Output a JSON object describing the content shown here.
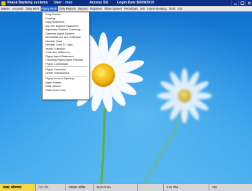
{
  "titlebar": {
    "app_name": "Vbank Banking systems",
    "user_label": "User :",
    "user_value": "msc",
    "access_label": "Access :",
    "access_value": "SU",
    "login_label": "Login Date :",
    "login_value": "16/09/2015"
  },
  "menubar": {
    "items": [
      "Master",
      "Accounts",
      "Daily Work",
      "Pigmy Work",
      "Daily Reports",
      "Reports",
      "Registers",
      "Share System",
      "Periodicals",
      "MIS",
      "House Keeping",
      "Tools",
      "Exit"
    ],
    "active_index": 3
  },
  "dropdown": {
    "items": [
      "Daily Entries",
      "Passing",
      "Daily Statement",
      "Ind. A/C Balance Statement",
      "Agentwise Balance Summary",
      "Datewise Agent Balance",
      "Monthwise Ind. A/C Collection",
      "Monthly Chart",
      "Monthly Chart 31 Days",
      "Yearly Collection",
      "Collection Difference",
      "Pigmy Agent Statement",
      "Checking Pigmy Agent Passing",
      "Pigmy Commission",
      "-",
      "Pigmy Correction",
      "Delete Transactions",
      "-",
      "Pigmy Account Opening",
      "Agent Master",
      "Data Upload",
      "Data Down Load"
    ]
  },
  "statusbar": {
    "cells": [
      "शाखा: कोपरगांव",
      "मेहा जोड",
      "व्यवहार तारीख",
      "१६/०९/२०१५",
      "",
      "१:४४ PM",
      "२९३"
    ]
  },
  "colors": {
    "titlebar_bg": "#0d2f86",
    "menu_active": "#2f63c5",
    "desktop_sky": "#1f8fe0",
    "status_branch_bg": "#f1d84a"
  }
}
